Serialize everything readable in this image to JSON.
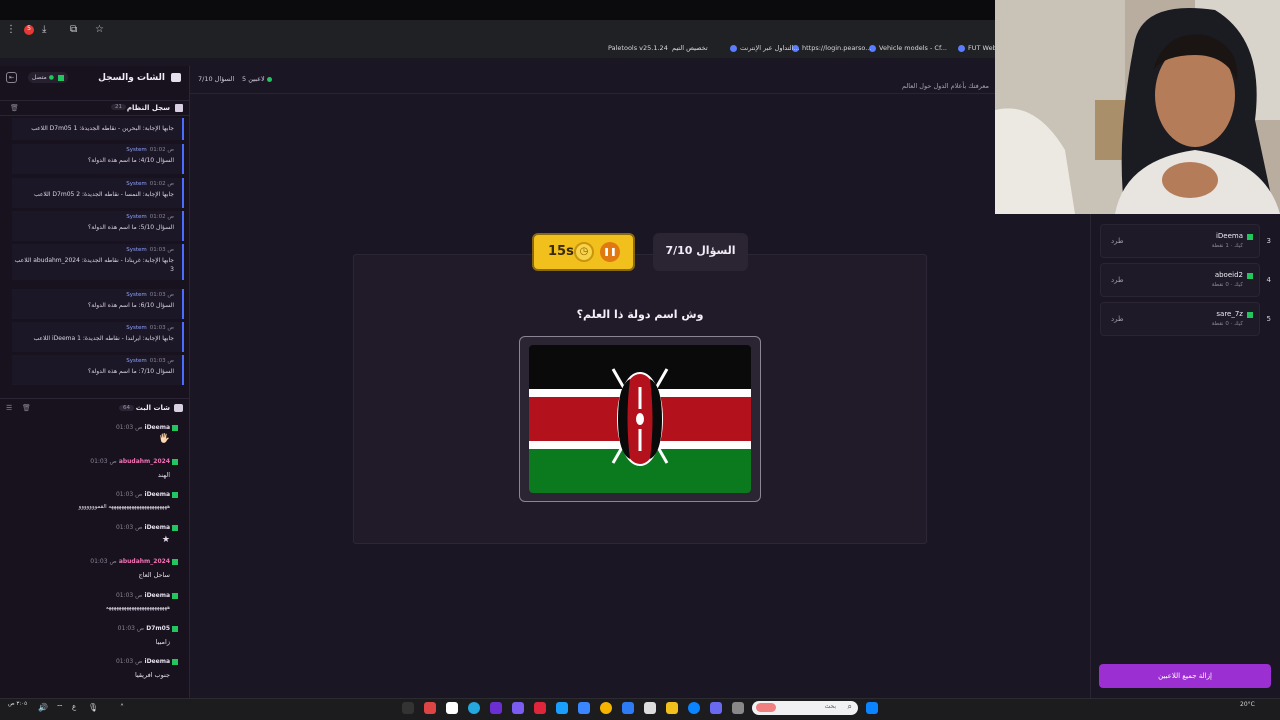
{
  "browser": {
    "bookmarks": [
      "FUT Web App",
      "Vehicle models - Cf...",
      "https://login.pearso...",
      "التداول عبر الإنترنت...",
      "تخصيص التيم",
      "Paletools v25.1.24"
    ]
  },
  "topbar": {
    "players": "5 لاعبين",
    "question": "السؤال 7/10",
    "subtitle": "معرفتك بأعلام الدول حول العالم"
  },
  "sidebar": {
    "title": "الشات والسجل",
    "status": "متصل",
    "system_log": {
      "title": "سجل النظام",
      "count": "21"
    },
    "log": [
      {
        "who": "System",
        "time": "01:02 ص",
        "msg": "اللاعب D7m05 جابها الإجابة: البحرين - نقاطه الجديدة: 1"
      },
      {
        "who": "System",
        "time": "01:02 ص",
        "msg": "السؤال 4/10: ما اسم هذه الدولة؟"
      },
      {
        "who": "System",
        "time": "01:02 ص",
        "msg": "اللاعب D7m05 جابها الإجابة: النمسا - نقاطه الجديدة: 2"
      },
      {
        "who": "System",
        "time": "01:02 ص",
        "msg": "السؤال 5/10: ما اسم هذه الدولة؟"
      },
      {
        "who": "System",
        "time": "01:03 ص",
        "msg": "اللاعب abudahm_2024 جابها الإجابة: غرينادا - نقاطه الجديدة: 3"
      },
      {
        "who": "System",
        "time": "01:03 ص",
        "msg": "السؤال 6/10: ما اسم هذه الدولة؟"
      },
      {
        "who": "System",
        "time": "01:03 ص",
        "msg": "اللاعب iDeema جابها الإجابة: ايرلندا - نقاطه الجديدة: 1"
      },
      {
        "who": "System",
        "time": "01:03 ص",
        "msg": "السؤال 7/10: ما اسم هذه الدولة؟"
      }
    ],
    "chat": {
      "title": "شات البث",
      "count": "64"
    },
    "messages": [
      {
        "who": "iDeema",
        "time": "01:03 ص",
        "text": "🖐🏻",
        "color": "#e6e0ee"
      },
      {
        "who": "abudahm_2024",
        "time": "01:03 ص",
        "text": "الهند",
        "color": "#f472b6"
      },
      {
        "who": "iDeema",
        "time": "01:03 ص",
        "text": "هههههههههههههههههههههههه القمووووووو",
        "color": "#e6e0ee"
      },
      {
        "who": "iDeema",
        "time": "01:03 ص",
        "text": "★",
        "color": "#e6e0ee"
      },
      {
        "who": "abudahm_2024",
        "time": "01:03 ص",
        "text": "ساحل العاج",
        "color": "#f472b6"
      },
      {
        "who": "iDeema",
        "time": "01:03 ص",
        "text": "ههههههههههههههههههههههههه",
        "color": "#e6e0ee"
      },
      {
        "who": "D7m05",
        "time": "01:03 ص",
        "text": "زامبيا",
        "color": "#e6e0ee"
      },
      {
        "who": "iDeema",
        "time": "01:03 ص",
        "text": "جنوب افريقيا",
        "color": "#e6e0ee"
      }
    ]
  },
  "main": {
    "timer": "15s",
    "question_label": "السؤال 7/10",
    "prompt": "وش اسم دولة ذا العلم؟"
  },
  "players": [
    {
      "rank": "3",
      "name": "iDeema",
      "pts": "كيك · 1 نقطة",
      "kick": "طرد"
    },
    {
      "rank": "4",
      "name": "aboeid2",
      "pts": "كيك · 0 نقطة",
      "kick": "طرد"
    },
    {
      "rank": "5",
      "name": "sare_7z",
      "pts": "كيك · 0 نقطة",
      "kick": "طرد"
    }
  ],
  "kick_all": "إزالة جميع اللاعبين",
  "taskbar": {
    "search": "بحث",
    "weather": "20°C",
    "clock": "٣:٠٥ ص"
  },
  "colors": {
    "accent": "#9b2fd1",
    "timer": "#f2c01d",
    "system": "#4b6dff"
  }
}
